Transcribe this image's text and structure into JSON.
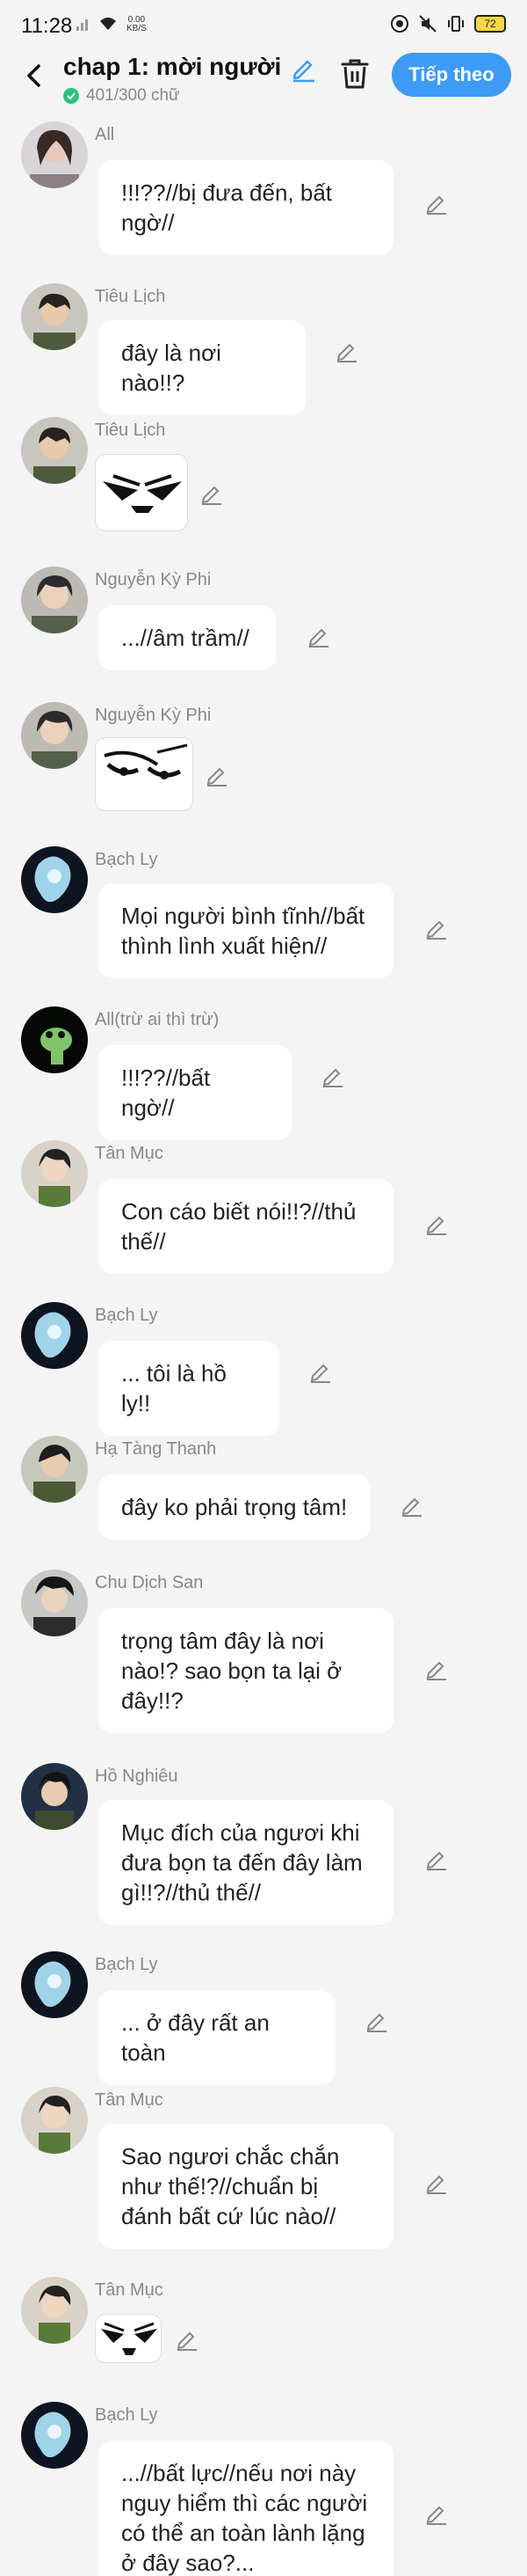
{
  "status_bar": {
    "time": "11:28",
    "net_speed_value": "0.00",
    "net_speed_unit": "KB/S",
    "battery": "72"
  },
  "header": {
    "title": "chap 1: mời người ...",
    "word_count": "401/300 chữ",
    "next_label": "Tiếp theo"
  },
  "colors": {
    "accent": "#3d9bf5",
    "check": "#2fc27a",
    "bubble": "#ffffff",
    "background": "#f4f4f4"
  },
  "messages": [
    {
      "name": "All",
      "text": "!!!??//bị đưa đến, bất ngờ//"
    },
    {
      "name": "Tiêu Lịch",
      "text": "đây là nơi nào!!?"
    },
    {
      "name": "Tiêu Lịch",
      "sticker": "anime-eyes-sticker"
    },
    {
      "name": "Nguyễn Kỳ Phi",
      "text": "...//âm trầm//"
    },
    {
      "name": "Nguyễn Kỳ Phi",
      "sticker": "anime-eyes-sticker"
    },
    {
      "name": "Bạch Ly",
      "text": "Mọi người bình tĩnh//bất thình lình xuất hiện//"
    },
    {
      "name": "All(trừ ai thì trừ)",
      "text": "!!!??//bất ngờ//"
    },
    {
      "name": "Tân Mục",
      "text": "Con cáo biết nói!!?//thủ thế//"
    },
    {
      "name": "Bạch Ly",
      "text": "... tôi là hồ ly!!"
    },
    {
      "name": "Hạ Tàng Thanh",
      "text": "đây ko phải trọng tâm!"
    },
    {
      "name": "Chu Dịch San",
      "text": "trọng tâm đây là nơi nào!? sao bọn ta lại ở đây!!?"
    },
    {
      "name": "Hồ Nghiêu",
      "text": "Mục đích của ngươi khi đưa bọn ta đến đây làm gì!!?//thủ thế//"
    },
    {
      "name": "Bạch Ly",
      "text": "... ở đây rất an toàn"
    },
    {
      "name": "Tân Mục",
      "text": "Sao ngươi chắc chắn như thế!?//chuẩn bị đánh bất cứ lúc nào//"
    },
    {
      "name": "Tân Mục",
      "sticker": "anime-eyes-sticker"
    },
    {
      "name": "Bạch Ly",
      "text": "...//bất lực//nếu nơi này nguy hiểm thì các người có thể an toàn lành lặng ở đây sao?..."
    }
  ]
}
